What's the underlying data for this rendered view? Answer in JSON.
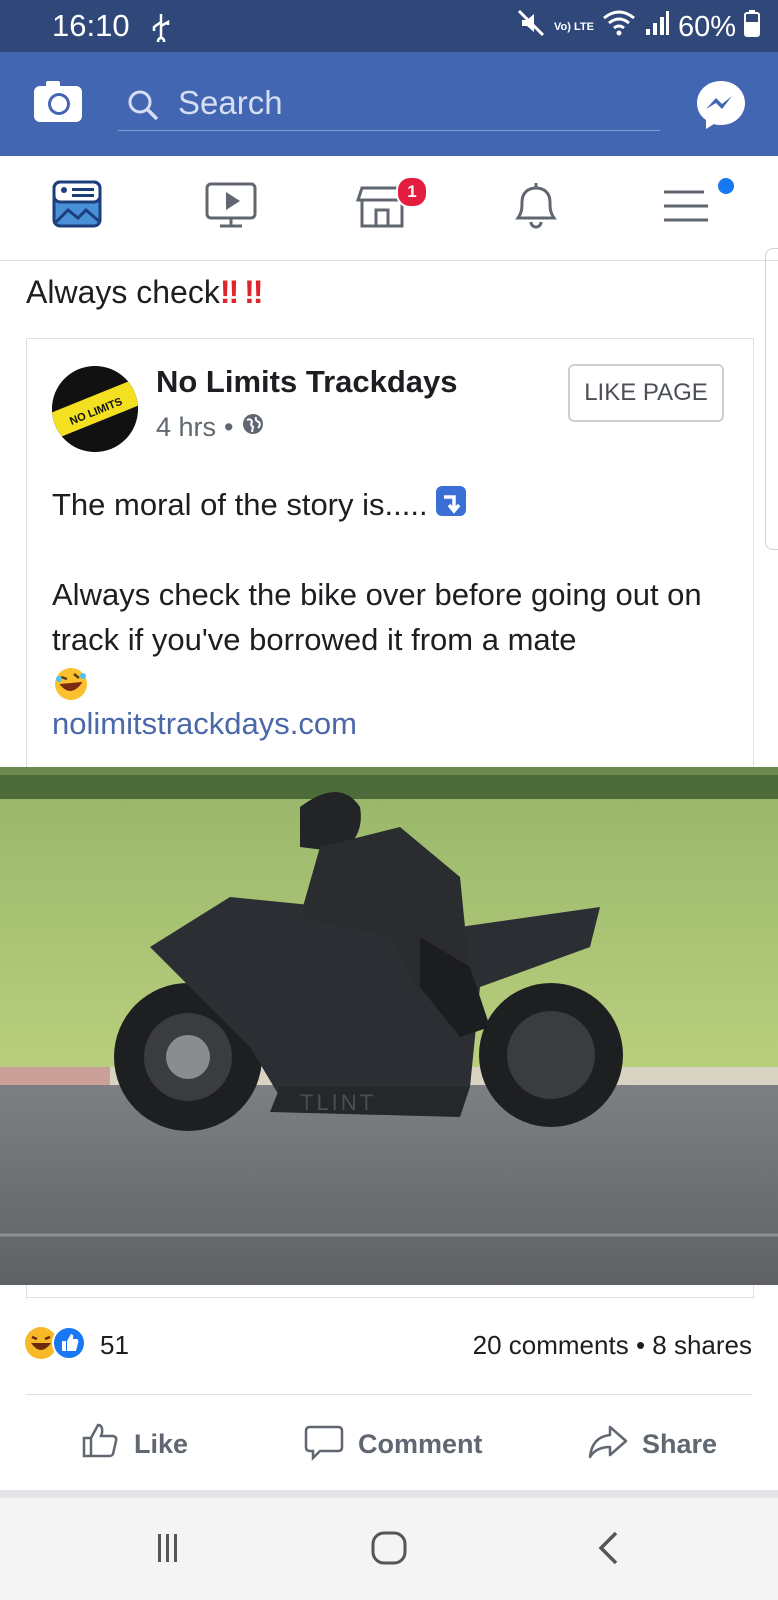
{
  "status_bar": {
    "time": "16:10",
    "network": "Vo) LTE",
    "battery": "60%"
  },
  "search": {
    "placeholder": "Search"
  },
  "nav": {
    "marketplace_badge": "1"
  },
  "post": {
    "caption_text": "Always check",
    "caption_emoji": "‼ ‼",
    "shared": {
      "page_name": "No Limits Trackdays",
      "time": "4 hrs",
      "like_page_label": "LIKE PAGE",
      "line1": "The moral of the story is.....",
      "line2": "Always check the bike over before going out on track if you've borrowed it from a mate",
      "link": "nolimitstrackdays.com",
      "avatar_text": "NO LIMITS"
    },
    "photo_fairing_text": "TLINT",
    "reaction_count": "51",
    "comments": "20 comments",
    "shares": "8 shares",
    "actions": {
      "like": "Like",
      "comment": "Comment",
      "share": "Share"
    }
  },
  "colors": {
    "status_bar": "#30477a",
    "app_bar": "#4266b2",
    "link": "#4b68a8",
    "badge": "#e41e3f"
  }
}
